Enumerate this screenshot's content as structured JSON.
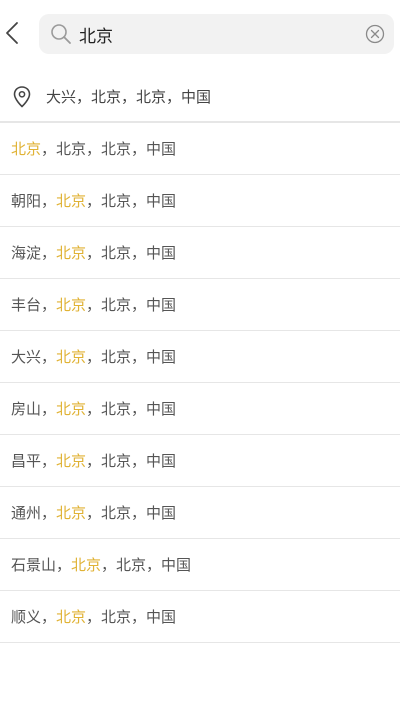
{
  "colors": {
    "highlight": "#e0b234",
    "text": "#555555",
    "divider": "#e6e6e6",
    "search_bg": "#f2f2f2"
  },
  "header": {
    "back_icon": "chevron-left-icon",
    "search": {
      "icon": "search-icon",
      "value": "北京",
      "clear_icon": "clear-circle-icon"
    }
  },
  "current_location": {
    "icon": "location-pin-icon",
    "text": "大兴，北京，北京，中国"
  },
  "results": [
    {
      "pre": "",
      "match": "北京",
      "post": "，北京，北京，中国"
    },
    {
      "pre": "朝阳，",
      "match": "北京",
      "post": "，北京，中国"
    },
    {
      "pre": "海淀，",
      "match": "北京",
      "post": "，北京，中国"
    },
    {
      "pre": "丰台，",
      "match": "北京",
      "post": "，北京，中国"
    },
    {
      "pre": "大兴，",
      "match": "北京",
      "post": "，北京，中国"
    },
    {
      "pre": "房山，",
      "match": "北京",
      "post": "，北京，中国"
    },
    {
      "pre": "昌平，",
      "match": "北京",
      "post": "，北京，中国"
    },
    {
      "pre": "通州，",
      "match": "北京",
      "post": "，北京，中国"
    },
    {
      "pre": "石景山，",
      "match": "北京",
      "post": "，北京，中国"
    },
    {
      "pre": "顺义，",
      "match": "北京",
      "post": "，北京，中国"
    }
  ]
}
